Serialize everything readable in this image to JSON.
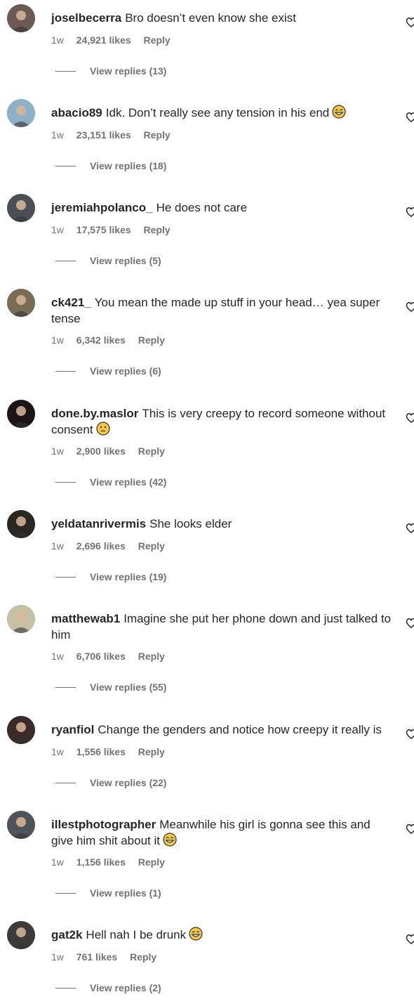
{
  "comments": [
    {
      "user": "joselbecerra",
      "text": "Bro doesn’t even know she exist",
      "emoji": "",
      "age": "1w",
      "likes": "24,921 likes",
      "reply": "Reply",
      "view_replies": "View replies (13)",
      "avatar_color": "#6b5a55"
    },
    {
      "user": "abacio89",
      "text": "Idk. Don’t really see any tension in his end",
      "emoji": "laughing-emoji",
      "age": "1w",
      "likes": "23,151 likes",
      "reply": "Reply",
      "view_replies": "View replies (18)",
      "avatar_color": "#8fb0c9"
    },
    {
      "user": "jeremiahpolanco_",
      "text": "He does not care",
      "emoji": "",
      "age": "1w",
      "likes": "17,575 likes",
      "reply": "Reply",
      "view_replies": "View replies (5)",
      "avatar_color": "#4a4f55"
    },
    {
      "user": "ck421_",
      "text": "You mean the made up stuff in your head… yea super tense",
      "emoji": "",
      "age": "1w",
      "likes": "6,342 likes",
      "reply": "Reply",
      "view_replies": "View replies (6)",
      "avatar_color": "#7a6d58"
    },
    {
      "user": "done.by.maslor",
      "text": "This is very creepy to record someone without consent",
      "emoji": "confused-emoji",
      "age": "1w",
      "likes": "2,900 likes",
      "reply": "Reply",
      "view_replies": "View replies (42)",
      "avatar_color": "#1c1418"
    },
    {
      "user": "yeldatanrivermis",
      "text": "She looks elder",
      "emoji": "",
      "age": "1w",
      "likes": "2,696 likes",
      "reply": "Reply",
      "view_replies": "View replies (19)",
      "avatar_color": "#2a2622"
    },
    {
      "user": "matthewab1",
      "text": "Imagine she put her phone down and just talked to him",
      "emoji": "",
      "age": "1w",
      "likes": "6,706 likes",
      "reply": "Reply",
      "view_replies": "View replies (55)",
      "avatar_color": "#c7c0a5"
    },
    {
      "user": "ryanfiol",
      "text": "Change the genders and notice how creepy it really is",
      "emoji": "",
      "age": "1w",
      "likes": "1,556 likes",
      "reply": "Reply",
      "view_replies": "View replies (22)",
      "avatar_color": "#3b2a2a"
    },
    {
      "user": "illestphotographer",
      "text": "Meanwhile his girl is gonna see this and give him shit about it",
      "emoji": "laughing-emoji",
      "age": "1w",
      "likes": "1,156 likes",
      "reply": "Reply",
      "view_replies": "View replies (1)",
      "avatar_color": "#505458"
    },
    {
      "user": "gat2k",
      "text": "Hell nah I be drunk",
      "emoji": "laughing-emoji",
      "age": "1w",
      "likes": "761 likes",
      "reply": "Reply",
      "view_replies": "View replies (2)",
      "avatar_color": "#3d3a3a"
    }
  ],
  "colors": {
    "text": "#262626",
    "secondary": "#737373"
  }
}
